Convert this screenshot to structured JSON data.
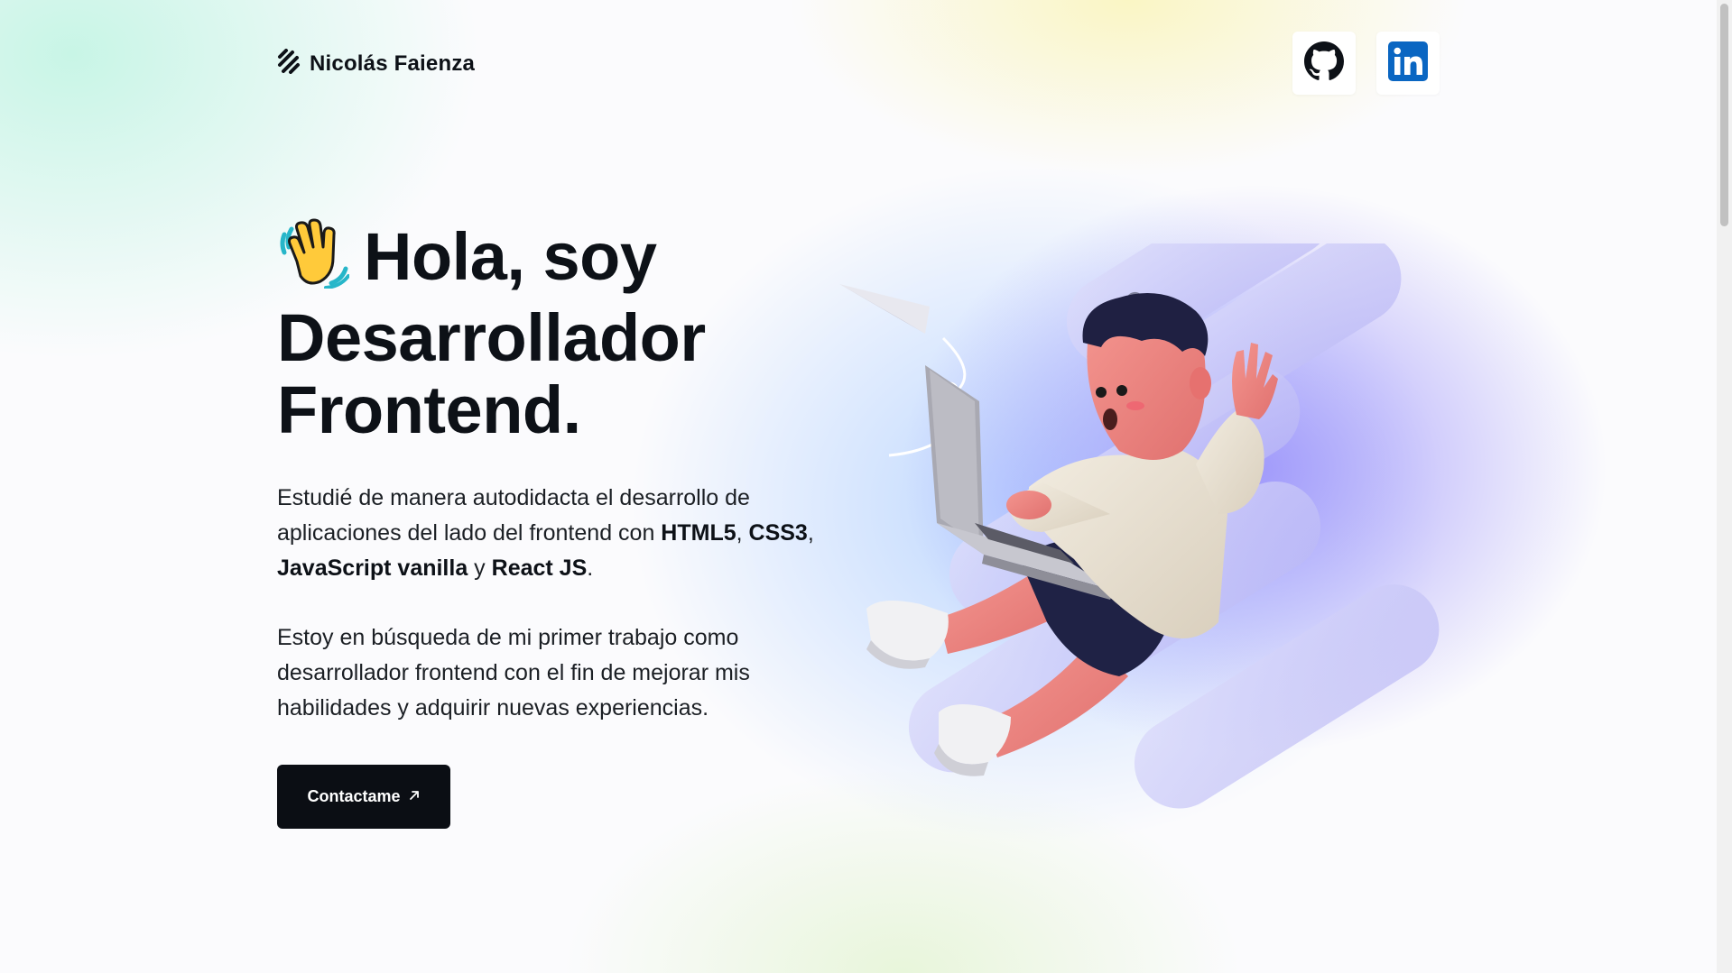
{
  "header": {
    "brand_name": "Nicolás Faienza",
    "brand_icon": "stripes-logo-icon",
    "social": [
      {
        "name": "GitHub",
        "icon": "github-icon"
      },
      {
        "name": "LinkedIn",
        "icon": "linkedin-icon",
        "color": "#0a66c2"
      }
    ]
  },
  "hero": {
    "wave_icon": "waving-hand-icon",
    "title_line1": "Hola, soy",
    "title_line2": "Desarrollador",
    "title_line3": "Frontend.",
    "para1": {
      "t1": "Estudié de manera autodidacta el desarrollo de aplicaciones del lado del frontend con ",
      "b1": "HTML5",
      "t2": ", ",
      "b2": "CSS3",
      "t3": ", ",
      "b3": "JavaScript vanilla",
      "t4": " y ",
      "b4": "React JS",
      "t5": "."
    },
    "para2": "Estoy en búsqueda de mi primer trabajo como desarrollador frontend con el fin de mejorar mis habilidades y adquirir nuevas experiencias.",
    "cta_label": "Contactame",
    "cta_icon": "arrow-up-right-icon"
  },
  "colors": {
    "button_bg": "#0b0e14",
    "accent_purple": "#9a92f7"
  }
}
